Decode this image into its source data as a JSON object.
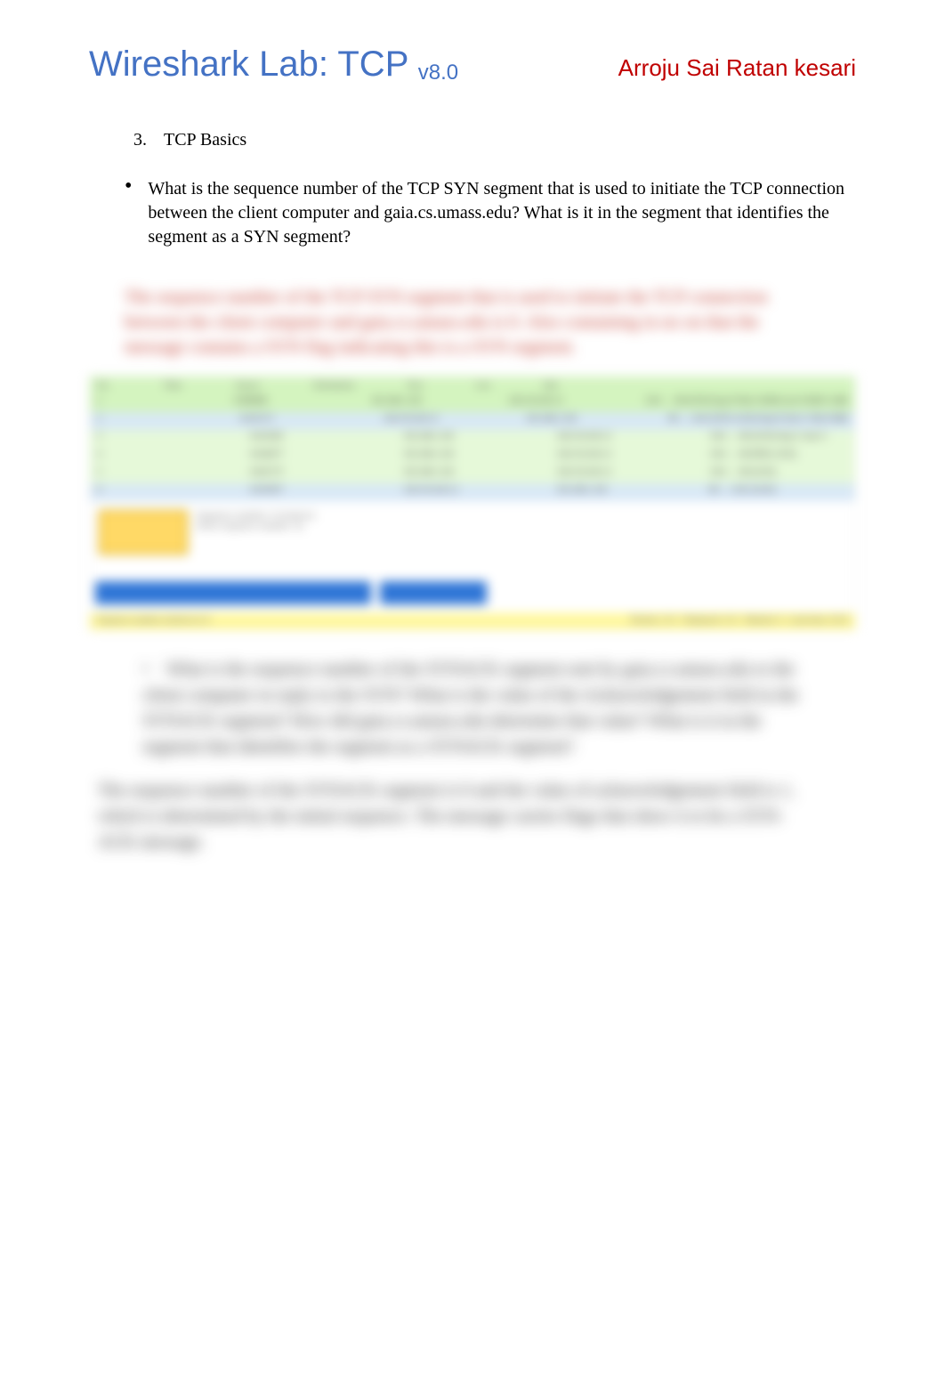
{
  "title": {
    "main": "Wireshark Lab:  TCP ",
    "version": "v8.0",
    "author": "Arroju Sai Ratan kesari"
  },
  "section": {
    "number": "3.",
    "label": "TCP Basics"
  },
  "question1": {
    "bullet": "•",
    "text": "What is the sequence number of the TCP SYN segment that is used to initiate the TCP connection between the client computer and gaia.cs.umass.edu?  What is it in the segment that identifies the segment as a SYN segment?"
  },
  "blurred_answer1": "The sequence number of the TCP SYN segment that is used to initiate the TCP connection between the client computer and gaia.cs.umass.edu is 0. Also containing in no on that the message contains a SYN flag indicating this is a SYN segment.",
  "table": {
    "headers": [
      "No.",
      "Time",
      "Source",
      "Destination",
      "Prot",
      "Len",
      "Info"
    ],
    "rows": [
      {
        "c": [
          "1",
          "0.000000",
          "192.168.1.102",
          "128.119.245.12",
          "TCP",
          "62",
          "1161 → 80 [SYN] Seq=0 Win=16384 Len=0 MSS=1460"
        ],
        "cls": "green"
      },
      {
        "c": [
          "2",
          "0.023172",
          "128.119.245.12",
          "192.168.1.102",
          "TCP",
          "62",
          "80 → 1161 [SYN, ACK] Seq=0 Ack=1 Win=5840"
        ],
        "cls": "blue"
      },
      {
        "c": [
          "3",
          "0.023265",
          "192.168.1.102",
          "128.119.245.12",
          "TCP",
          "54",
          "1161 → 80 [ACK] Seq=1 Ack=1"
        ],
        "cls": "greenlight"
      },
      {
        "c": [
          "4",
          "0.026477",
          "192.168.1.102",
          "128.119.245.12",
          "TCP",
          "619",
          "1161 → 80 [PSH, ACK]"
        ],
        "cls": "greenlight"
      },
      {
        "c": [
          "5",
          "0.041737",
          "192.168.1.102",
          "128.119.245.12",
          "TCP",
          "1514",
          "1161 → 80 [ACK]"
        ],
        "cls": "greenlight"
      },
      {
        "c": [
          "6",
          "0.053937",
          "128.119.245.12",
          "192.168.1.102",
          "TCP",
          "60",
          "80 → 1161 [ACK]"
        ],
        "cls": "blue"
      }
    ],
    "mid_text_a": "Sequence number: 0 (relative)",
    "mid_text_b": "[Next sequence number: 0]",
    "footer_left": "Sequence number (relative) is 0",
    "footer_right": "Packets: 213 · Displayed: 213 · Marked: 0 · Load time: 0:0.6"
  },
  "question2": {
    "bullet": "•",
    "text": "What is the sequence number of the SYNACK segment sent by gaia.cs.umass.edu to the client computer in reply to the SYN? What is the value of the Acknowledgement field in the SYNACK segment? How did gaia.cs.umass.edu determine that value? What is it in the segment that identifies the segment as a SYNACK segment?"
  },
  "blurred_answer2": "The sequence number of the SYNACK segment is 0 and the value of acknowledgement field is 1, which is determined by the initial sequence. The message carries flags that show it to be a SYN-ACK message."
}
